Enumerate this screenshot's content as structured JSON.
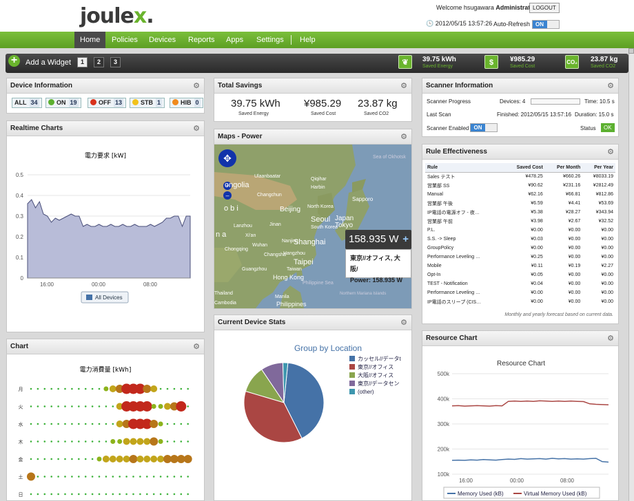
{
  "header": {
    "logo_main": "joule",
    "logo_x": "x",
    "logo_dot": ".",
    "welcome_prefix": "Welcome hsugawara",
    "welcome_role": "Administrator",
    "logout": "LOGOUT",
    "datetime": "2012/05/15 13:57:26",
    "auto_refresh": "Auto-Refresh",
    "toggle_on": "ON"
  },
  "nav": [
    "Home",
    "Policies",
    "Devices",
    "Reports",
    "Apps",
    "Settings",
    "Help"
  ],
  "toolbar": {
    "add_widget": "Add a Widget",
    "pages": [
      "1",
      "2",
      "3"
    ],
    "stats": [
      {
        "icon": "leaf-icon",
        "value": "39.75 kWh",
        "label": "Saved Energy"
      },
      {
        "icon": "dollar-icon",
        "value": "¥985.29",
        "label": "Saved Cost"
      },
      {
        "icon": "co2-icon",
        "value": "23.87 kg",
        "label": "Saved CO2"
      }
    ]
  },
  "device_info": {
    "title": "Device Information",
    "buttons": [
      {
        "label": "ALL",
        "count": "34",
        "color": ""
      },
      {
        "label": "ON",
        "count": "19",
        "color": "#5cb030"
      },
      {
        "label": "OFF",
        "count": "13",
        "color": "#d8321c"
      },
      {
        "label": "STB",
        "count": "1",
        "color": "#f2c21b"
      },
      {
        "label": "HIB",
        "count": "0",
        "color": "#f08a1c"
      }
    ]
  },
  "total_savings": {
    "title": "Total Savings",
    "items": [
      {
        "value": "39.75 kWh",
        "label": "Saved Energy"
      },
      {
        "value": "¥985.29",
        "label": "Saved Cost"
      },
      {
        "value": "23.87 kg",
        "label": "Saved CO2"
      }
    ]
  },
  "scanner": {
    "title": "Scanner Information",
    "progress_label": "Scanner Progress",
    "devices": "Devices: 4",
    "time": "Time: 10.5 s",
    "progress": 0.0,
    "last_scan_label": "Last Scan",
    "finished": "Finished: 2012/05/15 13:57:16",
    "duration": "Duration: 15.0 s",
    "enabled_label": "Scanner Enabled",
    "toggle": "ON",
    "status_label": "Status",
    "status": "OK"
  },
  "realtime": {
    "title": "Realtime Charts",
    "legend": "All Devices"
  },
  "maps": {
    "title": "Maps - Power",
    "popup_value": "158.935 W",
    "popup_location": "東京//オフィス, 大阪/",
    "popup_power": "Power: 158.935 W",
    "labels": [
      "Sea of Okhotsk",
      "Ulaanbaatar",
      "Qiqihar",
      "Harbin",
      "Sapporo",
      "Changchun",
      "Beijing",
      "North Korea",
      "Seoul",
      "South Korea",
      "Japan",
      "Tokyo",
      "Lanzhou",
      "Jinan",
      "Xi'an",
      "Nanjing",
      "Shanghai",
      "Wuhan",
      "Hangzhou",
      "Chongqing",
      "Changsha",
      "Taipei",
      "Taiwan",
      "Guangzhou",
      "Hong Kong",
      "Philippine Sea",
      "Thailand",
      "Cambodia",
      "Manila",
      "Philippines",
      "Northern Mariana Islands",
      "ongolia",
      "o b i",
      "n a"
    ]
  },
  "rule_eff": {
    "title": "Rule Effectiveness",
    "headers": [
      "Rule",
      "Saved Cost",
      "Per Month",
      "Per Year"
    ],
    "rows": [
      [
        "Sales テスト",
        "¥478.25",
        "¥660.26",
        "¥8033.19"
      ],
      [
        "営業部 SS",
        "¥90.62",
        "¥231.16",
        "¥2812.49"
      ],
      [
        "Manual",
        "¥62.16",
        "¥66.81",
        "¥812.86"
      ],
      [
        "営業部 午後",
        "¥6.59",
        "¥4.41",
        "¥53.69"
      ],
      [
        "IP電話の電源オフ - 夜…",
        "¥5.38",
        "¥28.27",
        "¥343.94"
      ],
      [
        "営業部 午前",
        "¥3.98",
        "¥2.67",
        "¥32.52"
      ],
      [
        "P.L.",
        "¥0.00",
        "¥0.00",
        "¥0.00"
      ],
      [
        "S.S. -> Sleep",
        "¥0.03",
        "¥0.00",
        "¥0.00"
      ],
      [
        "GroupPolicy",
        "¥0.00",
        "¥0.00",
        "¥0.00"
      ],
      [
        "Performance Leveling …",
        "¥0.25",
        "¥0.00",
        "¥0.00"
      ],
      [
        "Mobile",
        "¥0.11",
        "¥0.19",
        "¥2.27"
      ],
      [
        "Opt-In",
        "¥0.05",
        "¥0.00",
        "¥0.00"
      ],
      [
        "TEST - Notification",
        "¥0.04",
        "¥0.00",
        "¥0.00"
      ],
      [
        "Performance Leveling …",
        "¥0.00",
        "¥0.00",
        "¥0.00"
      ],
      [
        "IP電話のスリープ (CIS…",
        "¥0.00",
        "¥0.00",
        "¥0.00"
      ]
    ],
    "note": "Monthly and yearly forecast based on current data."
  },
  "chart_panel": {
    "title": "Chart"
  },
  "device_stats": {
    "title": "Current Device Stats"
  },
  "resource": {
    "title": "Resource Chart"
  },
  "chart_data": [
    {
      "type": "area",
      "title": "電力要求 [kW]",
      "x": [
        "16:00",
        "00:00",
        "08:00"
      ],
      "ylim": [
        0,
        0.5
      ],
      "yticks": [
        "0.5",
        "0.4",
        "0.3",
        "0.2",
        "0.1",
        "0"
      ],
      "series": [
        {
          "name": "All Devices",
          "values": [
            0.36,
            0.38,
            0.34,
            0.37,
            0.31,
            0.3,
            0.27,
            0.29,
            0.28,
            0.29,
            0.3,
            0.31,
            0.3,
            0.3,
            0.25,
            0.26,
            0.25,
            0.25,
            0.26,
            0.25,
            0.25,
            0.26,
            0.25,
            0.25,
            0.26,
            0.25,
            0.25,
            0.26,
            0.25,
            0.25,
            0.25,
            0.26,
            0.25,
            0.26,
            0.27,
            0.29,
            0.29,
            0.3,
            0.3,
            0.25,
            0.3,
            0.3
          ]
        }
      ]
    },
    {
      "type": "scatter",
      "title": "電力消費量 [kWh]",
      "categories": [
        "月",
        "火",
        "水",
        "木",
        "金",
        "土",
        "日"
      ],
      "rows": [
        [
          1,
          1,
          1,
          1,
          1,
          1,
          1,
          1,
          1,
          1,
          1,
          2,
          3,
          4,
          5,
          5,
          5,
          4,
          3,
          1,
          1,
          1,
          1,
          1
        ],
        [
          1,
          1,
          1,
          1,
          1,
          1,
          1,
          1,
          1,
          1,
          1,
          1,
          1,
          3,
          5,
          5,
          5,
          5,
          2,
          2,
          3,
          4,
          5,
          1
        ],
        [
          1,
          1,
          1,
          1,
          1,
          1,
          1,
          1,
          1,
          1,
          1,
          1,
          1,
          3,
          4,
          5,
          5,
          5,
          4,
          2,
          1,
          1,
          1,
          1
        ],
        [
          1,
          1,
          1,
          1,
          1,
          1,
          1,
          1,
          1,
          1,
          1,
          1,
          2,
          2,
          3,
          3,
          3,
          3,
          4,
          2,
          1,
          1,
          1,
          1
        ],
        [
          1,
          1,
          1,
          1,
          1,
          1,
          1,
          1,
          1,
          1,
          2,
          3,
          3,
          3,
          3,
          4,
          3,
          3,
          3,
          3,
          4,
          4,
          4,
          4
        ],
        [
          4,
          1,
          1,
          1,
          1,
          1,
          1,
          1,
          1,
          1,
          1,
          1,
          1,
          1,
          1,
          1,
          1,
          1,
          1,
          1,
          1,
          1,
          1,
          1
        ],
        [
          1,
          1,
          1,
          1,
          1,
          1,
          1,
          1,
          1,
          1,
          1,
          1,
          1,
          1,
          1,
          1,
          1,
          1,
          1,
          1,
          1,
          1,
          1,
          1
        ]
      ]
    },
    {
      "type": "pie",
      "title": "Group by Location",
      "slices": [
        {
          "name": "カッセル//データt",
          "value": 41,
          "color": "#4572a7"
        },
        {
          "name": "東京//オフィス",
          "value": 37,
          "color": "#aa4643"
        },
        {
          "name": "大阪//オフィス",
          "value": 11,
          "color": "#89a54e"
        },
        {
          "name": "東京//データセン",
          "value": 9,
          "color": "#80699b"
        },
        {
          "name": "(other)",
          "value": 2,
          "color": "#3d96ae"
        }
      ]
    },
    {
      "type": "line",
      "title": "Resource Chart",
      "x": [
        "16:00",
        "00:00",
        "08:00"
      ],
      "ylim": [
        100,
        500
      ],
      "yticks": [
        "500k",
        "400k",
        "300k",
        "200k",
        "100k"
      ],
      "series": [
        {
          "name": "Memory Used (kB)",
          "color": "#4572a7",
          "values": [
            155,
            156,
            155,
            157,
            156,
            158,
            157,
            156,
            158,
            160,
            159,
            162,
            160,
            161,
            162,
            160,
            163,
            161,
            162,
            160,
            161,
            160,
            162,
            163,
            150,
            148
          ]
        },
        {
          "name": "Virtual Memory Used (kB)",
          "color": "#aa4643",
          "values": [
            372,
            373,
            371,
            372,
            373,
            372,
            371,
            373,
            372,
            390,
            391,
            390,
            391,
            390,
            392,
            391,
            390,
            391,
            390,
            391,
            390,
            389,
            380,
            378,
            377,
            376
          ]
        }
      ]
    }
  ]
}
